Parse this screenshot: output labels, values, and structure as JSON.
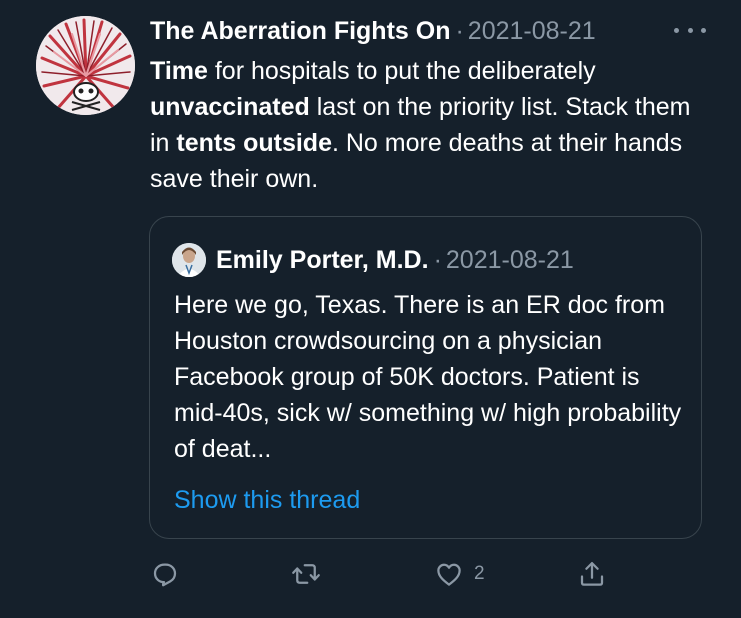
{
  "tweet": {
    "author": "The Aberration Fights On",
    "separator": "·",
    "date": "2021-08-21",
    "text_parts": {
      "p1": "Time",
      "p2": " for hospitals to put the deliberately ",
      "p3": "unvaccinated",
      "p4": " last on the priority list. Stack them in ",
      "p5": "tents outside",
      "p6": ". No more deaths at their hands save their own."
    }
  },
  "quote": {
    "author": "Emily Porter, M.D.",
    "separator": "·",
    "date": "2021-08-21",
    "text": "Here we go, Texas. There is an ER doc from Houston crowdsourcing on a physician Facebook group of 50K doctors. Patient is mid-40s, sick w/ something w/ high probability of deat...",
    "show_thread": "Show this thread"
  },
  "actions": {
    "reply_icon": "reply-icon",
    "retweet_icon": "retweet-icon",
    "like_icon": "heart-icon",
    "like_count": "2",
    "share_icon": "share-icon"
  },
  "colors": {
    "background": "#15202b",
    "secondary_text": "#8b98a5",
    "link": "#1d9bf0",
    "border": "#38444d"
  }
}
